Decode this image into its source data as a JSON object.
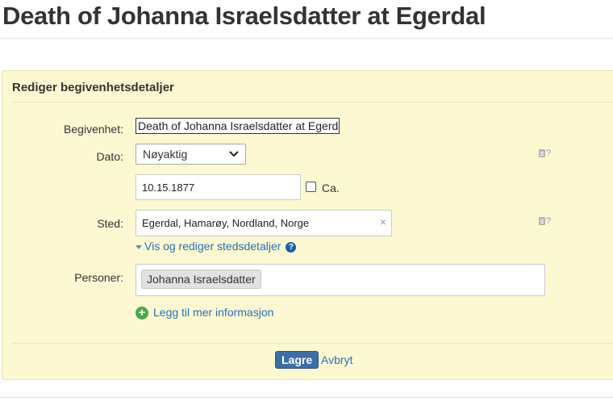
{
  "page": {
    "title": "Death of Johanna Israelsdatter at Egerdal"
  },
  "panel": {
    "heading": "Rediger begivenhetsdetaljer"
  },
  "form": {
    "event_label": "Begivenhet:",
    "event_value": "Death of Johanna Israelsdatter at Egerdal",
    "date_label": "Dato:",
    "date_type_selected": "Nøyaktig",
    "date_value": "10.15.1877",
    "circa_label": "Ca.",
    "circa_checked": false,
    "place_label": "Sted:",
    "place_value": "Egerdal, Hamarøy, Nordland, Norge",
    "place_clear": "×",
    "place_details_link": "Vis og rediger stedsdetaljer",
    "help_mark": "?",
    "persons_label": "Personer:",
    "persons": [
      "Johanna Israelsdatter"
    ],
    "add_more_link": "Legg til mer informasjon"
  },
  "actions": {
    "save_label": "Lagre",
    "cancel_label": "Avbryt"
  },
  "icons": {
    "doc_help": "?",
    "info_help": "?",
    "add": "+",
    "chevron": "▾"
  },
  "colors": {
    "panel_background": "#fcf8d2",
    "link": "#2a6fb5",
    "save_button": "#3d6ea8",
    "add_icon": "#4aa84a"
  }
}
